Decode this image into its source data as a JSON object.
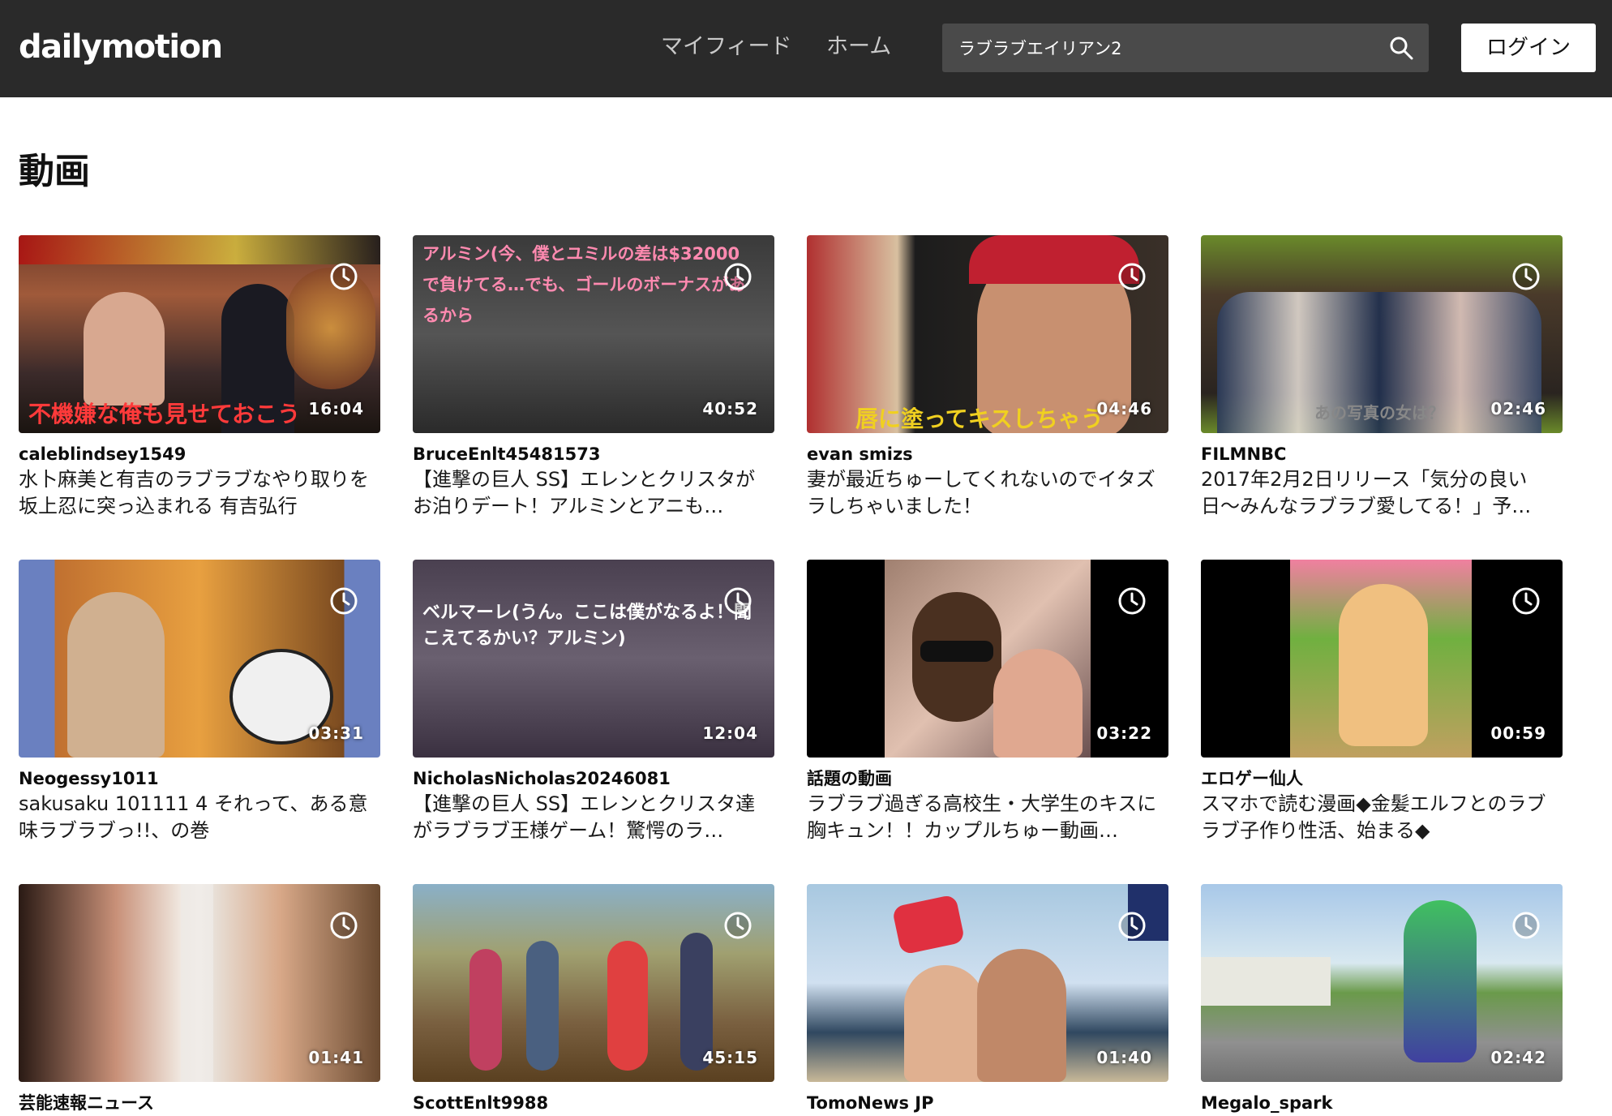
{
  "header": {
    "logo": "dailymotion",
    "nav": [
      "マイフィード",
      "ホーム"
    ],
    "search_value": "ラブラブエイリアン2",
    "login_label": "ログイン"
  },
  "colors": {
    "topbar": "#2a2a2a",
    "search_bg": "#4a4a4a",
    "login_bg": "#ffffff"
  },
  "section_title": "動画",
  "videos": [
    {
      "channel": "caleblindsey1549",
      "title": "水卜麻美と有吉のラブラブなやり取りを坂上忍に突っ込まれる 有吉弘行",
      "duration": "16:04",
      "overlay": "不機嫌な俺も見せておこう"
    },
    {
      "channel": "BruceEnlt45481573",
      "title": "【進撃の巨人 SS】エレンとクリスタがお泊りデート！アルミンとアニも…",
      "duration": "40:52",
      "overlay": "アルミン(今、僕とユミルの差は$32000で負けてる…でも、ゴールのボーナスがあるから"
    },
    {
      "channel": "evan smizs",
      "title": "妻が最近ちゅーしてくれないのでイタズラしちゃいました！",
      "duration": "04:46",
      "overlay": "唇に塗ってキスしちゃう"
    },
    {
      "channel": "FILMNBC",
      "title": "2017年2月2日リリース「気分の良い日〜みんなラブラブ愛してる！」予…",
      "duration": "02:46",
      "overlay": "あの写真の女は？"
    },
    {
      "channel": "Neogessy1011",
      "title": "sakusaku 101111 4 それって、ある意味ラブラブっ!!、の巻",
      "duration": "03:31",
      "overlay": ""
    },
    {
      "channel": "NicholasNicholas20246081",
      "title": "【進撃の巨人 SS】エレンとクリスタ達がラブラブ王様ゲーム！驚愕のラ…",
      "duration": "12:04",
      "overlay": "ベルマーレ(うん。ここは僕がなるよ！聞こえてるかい？アルミン)"
    },
    {
      "channel": "話題の動画",
      "title": "ラブラブ過ぎる高校生・大学生のキスに胸キュン！！カップルちゅー動画…",
      "duration": "03:22",
      "overlay": ""
    },
    {
      "channel": "エロゲー仙人",
      "title": "スマホで読む漫画◆金髪エルフとのラブラブ子作り性活、始まる◆",
      "duration": "00:59",
      "overlay": ""
    },
    {
      "channel": "芸能速報ニュース",
      "title": "",
      "duration": "01:41",
      "overlay": ""
    },
    {
      "channel": "ScottEnlt9988",
      "title": "",
      "duration": "45:15",
      "overlay": ""
    },
    {
      "channel": "TomoNews JP",
      "title": "",
      "duration": "01:40",
      "overlay": ""
    },
    {
      "channel": "Megalo_spark",
      "title": "",
      "duration": "02:42",
      "overlay": ""
    }
  ]
}
